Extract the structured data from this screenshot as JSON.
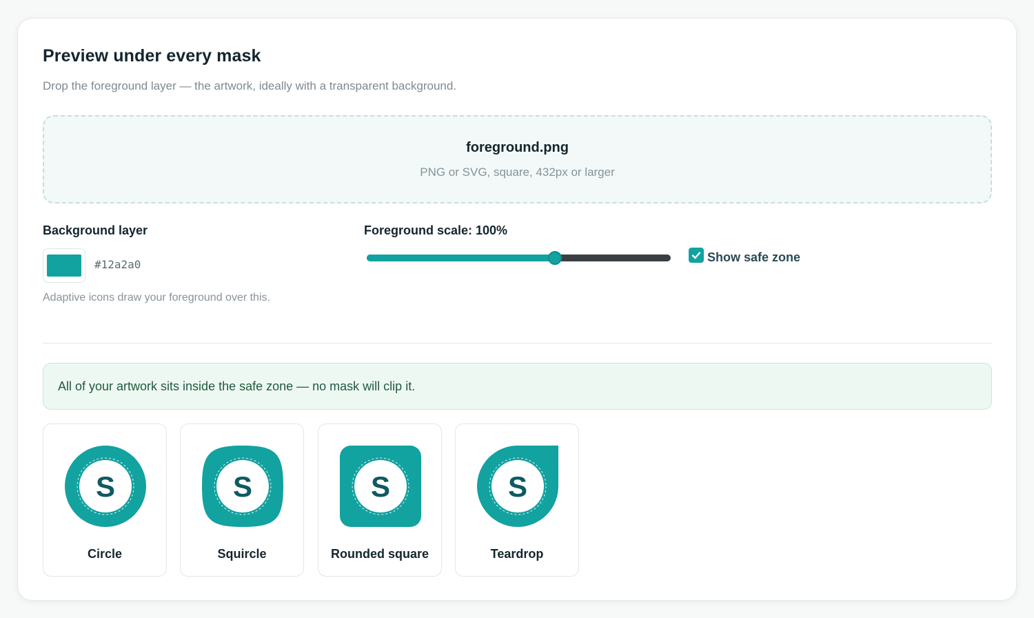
{
  "header": {
    "title": "Preview under every mask",
    "subtitle": "Drop the foreground layer — the artwork, ideally with a transparent background."
  },
  "dropzone": {
    "filename": "foreground.png",
    "hint": "PNG or SVG, square, 432px or larger"
  },
  "background": {
    "label": "Background layer",
    "color": "#12a2a0",
    "hex_text": "#12a2a0",
    "hint": "Adaptive icons draw your foreground over this."
  },
  "scale": {
    "label": "Foreground scale: 100%",
    "value_fraction": 0.62
  },
  "safe_zone": {
    "label": "Show safe zone",
    "checked": true
  },
  "notice": {
    "text": "All of your artwork sits inside the safe zone — no mask will clip it."
  },
  "masks": [
    {
      "name": "Circle",
      "glyph": "S"
    },
    {
      "name": "Squircle",
      "glyph": "S"
    },
    {
      "name": "Rounded square",
      "glyph": "S"
    },
    {
      "name": "Teardrop",
      "glyph": "S"
    }
  ],
  "colors": {
    "accent": "#12a2a0",
    "glyph": "#0f5a63",
    "notice_bg": "#eef8f3"
  }
}
